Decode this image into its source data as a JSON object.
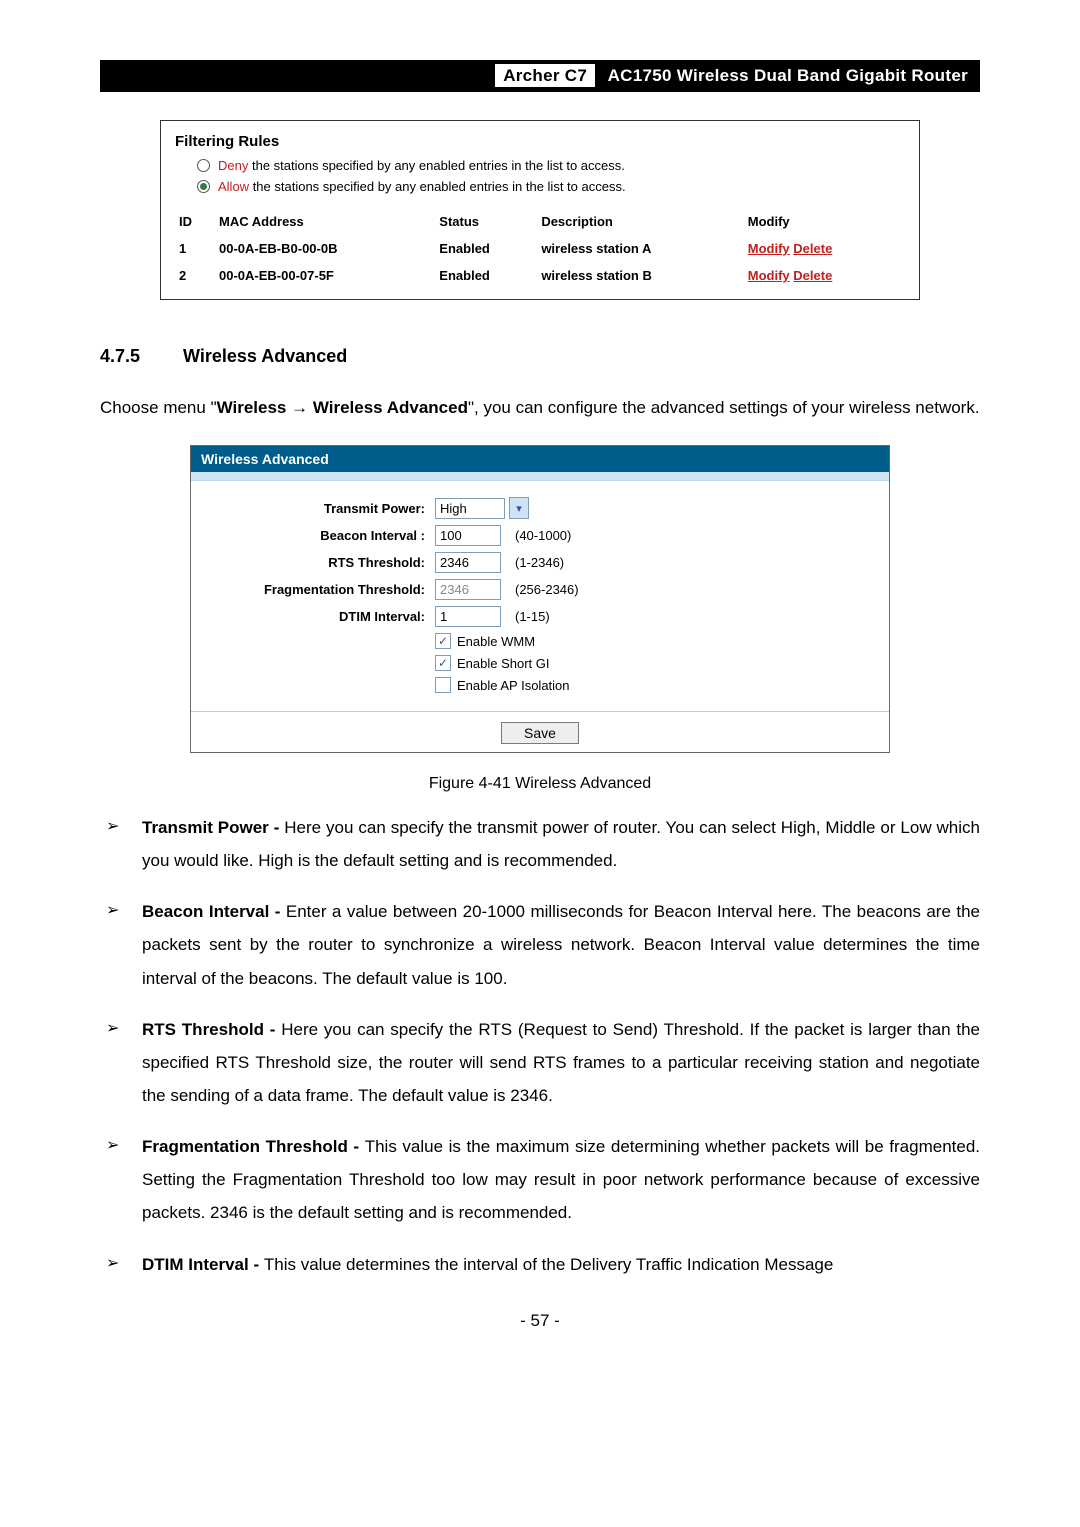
{
  "header": {
    "model": "Archer C7",
    "title": "AC1750 Wireless Dual Band Gigabit Router"
  },
  "filtering": {
    "title": "Filtering Rules",
    "denyKeyword": "Deny",
    "denyRest": " the stations specified by any enabled entries in the list to access.",
    "allowKeyword": "Allow",
    "allowRest": " the stations specified by any enabled entries in the list to access.",
    "columns": {
      "id": "ID",
      "mac": "MAC Address",
      "status": "Status",
      "desc": "Description",
      "modify": "Modify"
    },
    "rows": [
      {
        "id": "1",
        "mac": "00-0A-EB-B0-00-0B",
        "status": "Enabled",
        "desc": "wireless station A",
        "modify": "Modify",
        "delete": "Delete"
      },
      {
        "id": "2",
        "mac": "00-0A-EB-00-07-5F",
        "status": "Enabled",
        "desc": "wireless station B",
        "modify": "Modify",
        "delete": "Delete"
      }
    ]
  },
  "section": {
    "number": "4.7.5",
    "title": "Wireless Advanced",
    "intro_pre": "Choose menu \"",
    "intro_b1": "Wireless",
    "intro_arrow": " → ",
    "intro_b2": "Wireless Advanced",
    "intro_post": "\", you can configure the advanced settings of your wireless network."
  },
  "wirelessAdvanced": {
    "panelTitle": "Wireless Advanced",
    "transmitPowerLabel": "Transmit Power:",
    "transmitPowerValue": "High",
    "beaconLabel": "Beacon Interval :",
    "beaconValue": "100",
    "beaconHint": "(40-1000)",
    "rtsLabel": "RTS Threshold:",
    "rtsValue": "2346",
    "rtsHint": "(1-2346)",
    "fragLabel": "Fragmentation Threshold:",
    "fragValue": "2346",
    "fragHint": "(256-2346)",
    "dtimLabel": "DTIM Interval:",
    "dtimValue": "1",
    "dtimHint": "(1-15)",
    "wmm": "Enable WMM",
    "shortGi": "Enable Short GI",
    "apIso": "Enable AP Isolation",
    "save": "Save"
  },
  "figureCaption": "Figure 4-41 Wireless Advanced",
  "bullets": {
    "tp_b": "Transmit Power - ",
    "tp": "Here you can specify the transmit power of router. You can select High, Middle or Low which you would like. High is the default setting and is recommended.",
    "bi_b": "Beacon Interval - ",
    "bi": "Enter a value between 20-1000 milliseconds for Beacon Interval here. The beacons are the packets sent by the router to synchronize a wireless network. Beacon Interval value determines the time interval of the beacons. The default value is 100.",
    "rts_b": "RTS Threshold - ",
    "rts": "Here you can specify the RTS (Request to Send) Threshold. If the packet is larger than the specified RTS Threshold size, the router will send RTS frames to a particular receiving station and negotiate the sending of a data frame. The default value is 2346.",
    "ft_b": "Fragmentation Threshold - ",
    "ft": "This value is the maximum size determining whether packets will be fragmented. Setting the Fragmentation Threshold too low may result in poor network performance because of excessive packets. 2346 is the default setting and is recommended.",
    "dtim_b": "DTIM Interval - ",
    "dtim": "This value determines the interval of the Delivery Traffic Indication Message"
  },
  "pageNumber": "- 57 -"
}
